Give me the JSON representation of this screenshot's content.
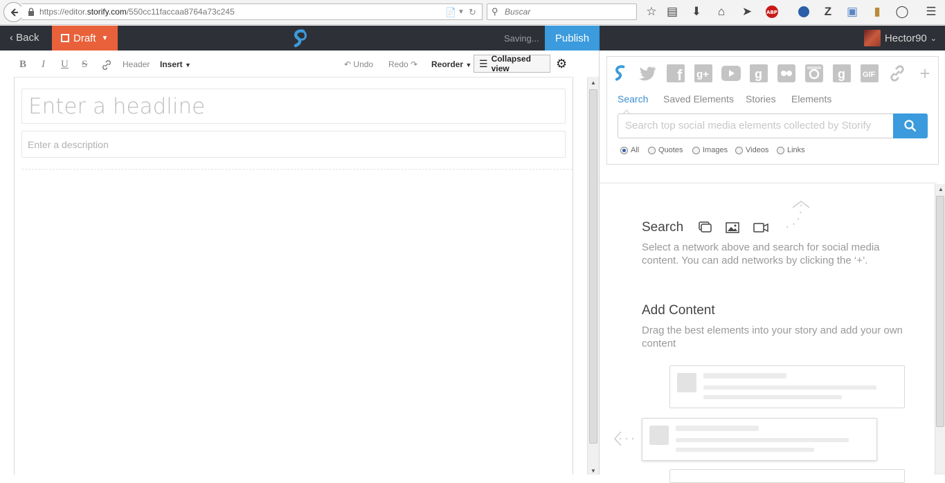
{
  "browser": {
    "url_prefix": "https://editor.",
    "url_domain": "storify.com",
    "url_path": "/550cc11faccaa8764a73c245",
    "search_placeholder": "Buscar"
  },
  "header": {
    "back_label": "Back",
    "draft_label": "Draft",
    "saving_label": "Saving...",
    "publish_label": "Publish",
    "username": "Hector90"
  },
  "toolbar": {
    "bold": "B",
    "italic": "I",
    "underline": "U",
    "strike": "S",
    "header_label": "Header",
    "insert_label": "Insert",
    "undo_label": "Undo",
    "redo_label": "Redo",
    "reorder_label": "Reorder",
    "collapsed_label": "Collapsed view"
  },
  "editor": {
    "headline_placeholder": "Enter a headline",
    "description_placeholder": "Enter a description"
  },
  "sources": {
    "networks": [
      "storify-icon",
      "twitter-icon",
      "facebook-icon",
      "google-plus-icon",
      "youtube-icon",
      "google-icon",
      "flickr-icon",
      "instagram-icon",
      "google-search-icon",
      "gif-icon",
      "link-icon",
      "add-icon"
    ],
    "tabs": [
      "Search",
      "Saved Elements",
      "Stories",
      "Elements"
    ],
    "search_placeholder": "Search top social media elements collected by Storify",
    "filters": [
      "All",
      "Quotes",
      "Images",
      "Videos",
      "Links"
    ],
    "selected_filter": "All"
  },
  "help": {
    "search_title": "Search",
    "search_body": "Select a network above and search for social media content. You can add networks by clicking the ‘+’.",
    "add_title": "Add Content",
    "add_body": "Drag the best elements into your story and add your own content"
  },
  "colors": {
    "header_bg": "#2e3037",
    "draft_orange": "#e9613a",
    "publish_blue": "#3b9bdc"
  }
}
